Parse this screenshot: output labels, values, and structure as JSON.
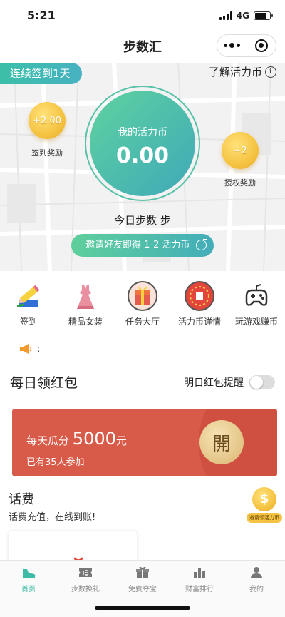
{
  "status_bar": {
    "time": "5:21",
    "network": "4G"
  },
  "nav": {
    "title": "步数汇"
  },
  "hero": {
    "streak_label": "连续签到1天",
    "learn_label": "了解活力币",
    "info_glyph": "i",
    "checkin_coin": {
      "value": "+2.00",
      "label": "签到奖励"
    },
    "auth_coin": {
      "value": "+2",
      "label": "授权奖励"
    },
    "ring_label": "我的活力币",
    "ring_value": "0.00",
    "steps_today": "今日步数 步",
    "invite_label": "邀请好友即得 1-2 活力币"
  },
  "entries": [
    {
      "label": "签到",
      "icon": "pencil-checkin-icon"
    },
    {
      "label": "精品女装",
      "icon": "dress-icon"
    },
    {
      "label": "任务大厅",
      "icon": "gift-box-icon"
    },
    {
      "label": "活力币详情",
      "icon": "coin-detail-icon"
    },
    {
      "label": "玩游戏赚币",
      "icon": "gamepad-icon"
    }
  ],
  "notice": {
    "text": ":"
  },
  "daily": {
    "title": "每日领红包",
    "remind_label": "明日红包提醒",
    "remind_on": false
  },
  "packet": {
    "line1_prefix": "每天瓜分",
    "line1_amount": "5000",
    "line1_unit": "元",
    "participants": "已有35人参加",
    "open_label": "開"
  },
  "bill": {
    "title": "话费",
    "subtitle": "话费充值，在线到账!"
  },
  "float_coin": {
    "glyph": "$",
    "label": "邀请领活力币"
  },
  "tabs": [
    {
      "label": "首页",
      "icon": "shoe-icon",
      "active": true
    },
    {
      "label": "步数换礼",
      "icon": "ticket-icon",
      "active": false
    },
    {
      "label": "免费夺宝",
      "icon": "treasure-box-icon",
      "active": false
    },
    {
      "label": "财富排行",
      "icon": "bar-chart-icon",
      "active": false
    },
    {
      "label": "我的",
      "icon": "user-icon",
      "active": false
    }
  ],
  "colors": {
    "accent": "#3dbba5",
    "packet_red": "#d85a49",
    "coin_gold": "#f5c342"
  }
}
